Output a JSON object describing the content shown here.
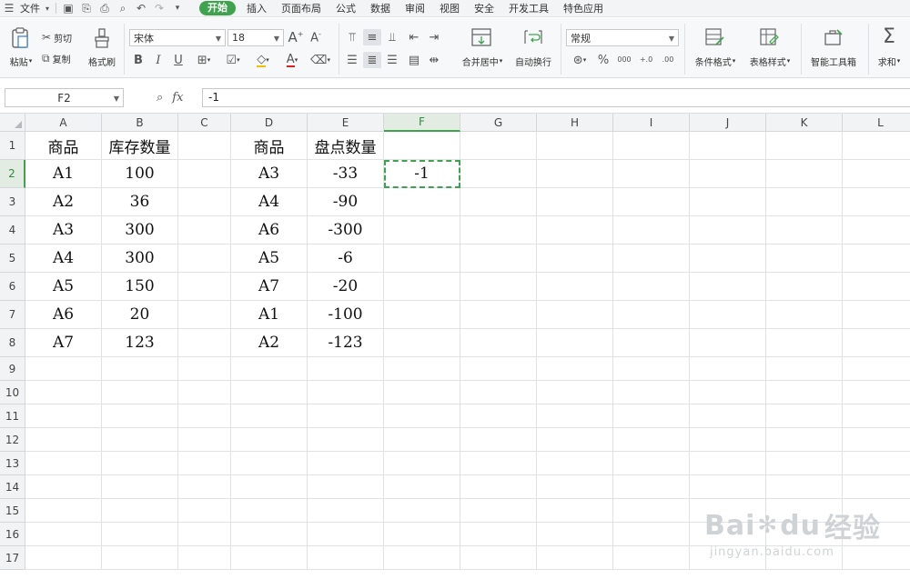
{
  "menubar": {
    "file_label": "文件",
    "tabs": [
      {
        "label": "开始",
        "active": true
      },
      {
        "label": "插入",
        "active": false
      },
      {
        "label": "页面布局",
        "active": false
      },
      {
        "label": "公式",
        "active": false
      },
      {
        "label": "数据",
        "active": false
      },
      {
        "label": "审阅",
        "active": false
      },
      {
        "label": "视图",
        "active": false
      },
      {
        "label": "安全",
        "active": false
      },
      {
        "label": "开发工具",
        "active": false
      },
      {
        "label": "特色应用",
        "active": false
      }
    ]
  },
  "ribbon": {
    "paste_label": "粘贴",
    "cut_label": "剪切",
    "copy_label": "复制",
    "format_painter_label": "格式刷",
    "font_name": "宋体",
    "font_size": "18",
    "merge_center_label": "合并居中",
    "wrap_text_label": "自动换行",
    "number_format": "常规",
    "cond_format_label": "条件格式",
    "table_style_label": "表格样式",
    "smart_toolbox_label": "智能工具箱",
    "sum_label": "求和",
    "bold_glyph": "B",
    "italic_glyph": "I",
    "underline_glyph": "U",
    "percent_glyph": "%",
    "thousands_glyph": "000",
    "dec_inc_glyph": "+.0",
    "dec_dec_glyph": ".00"
  },
  "formula_bar": {
    "name_box": "F2",
    "fx_label": "fx",
    "formula_value": "-1"
  },
  "sheet": {
    "columns": [
      "A",
      "B",
      "C",
      "D",
      "E",
      "F",
      "G",
      "H",
      "I",
      "J",
      "K",
      "L"
    ],
    "rows": [
      "1",
      "2",
      "3",
      "4",
      "5",
      "6",
      "7",
      "8",
      "9",
      "10",
      "11",
      "12",
      "13",
      "14",
      "15",
      "16",
      "17"
    ],
    "selected_column": "F",
    "selected_row": "2",
    "cells": [
      [
        "商品",
        "库存数量",
        "",
        "商品",
        "盘点数量",
        ""
      ],
      [
        "A1",
        "100",
        "",
        "A3",
        "-33",
        "-1"
      ],
      [
        "A2",
        "36",
        "",
        "A4",
        "-90",
        ""
      ],
      [
        "A3",
        "300",
        "",
        "A6",
        "-300",
        ""
      ],
      [
        "A4",
        "300",
        "",
        "A5",
        "-6",
        ""
      ],
      [
        "A5",
        "150",
        "",
        "A7",
        "-20",
        ""
      ],
      [
        "A6",
        "20",
        "",
        "A1",
        "-100",
        ""
      ],
      [
        "A7",
        "123",
        "",
        "A2",
        "-123",
        ""
      ]
    ]
  },
  "watermark": {
    "brand": "Bai du 经验",
    "brand_left": "Bai",
    "brand_mid": "du",
    "brand_right": "经验",
    "url": "jingyan.baidu.com"
  },
  "colors": {
    "accent": "#3fa34d"
  }
}
